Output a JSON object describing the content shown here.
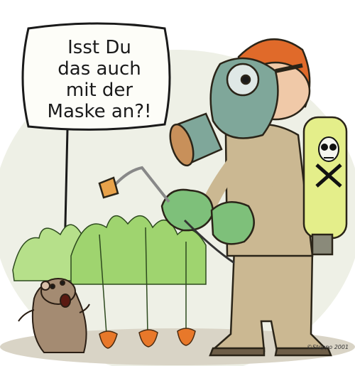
{
  "speech_bubble": {
    "lines": [
      "Isst Du",
      "das auch",
      "mit der",
      "Maske an?!"
    ]
  },
  "signature": "©Stoppo 2001",
  "icons": {
    "tank_label": "skull-crossbones-icon"
  },
  "colors": {
    "background": "#eef0e6",
    "hair": "#e06a2a",
    "mask": "#7fa79a",
    "suit": "#cbb892",
    "gloves": "#7ec07a",
    "tank": "#e4ee8a",
    "carrot": "#e8782a",
    "leaves": "#9fd46f",
    "hamster": "#a48b72"
  }
}
